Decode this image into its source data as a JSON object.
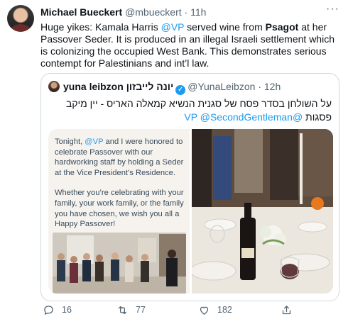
{
  "tweet": {
    "author_name": "Michael Bueckert",
    "author_handle": "@mbueckert",
    "separator": "·",
    "time": "11h",
    "more_label": "···",
    "text_1": "Huge yikes: Kamala Harris ",
    "mention_vp": "@VP",
    "text_2": " served wine from ",
    "bold_word": "Psagot",
    "text_3": " at her Passover Seder. It is produced in an illegal Israeli settlement which is colonizing the occupied West Bank. This demonstrates serious contempt for Palestinians and int’l law."
  },
  "quote": {
    "author_name": "yuna leibzon יונה לייבזון",
    "verified_glyph": "✓",
    "author_handle": "@YunaLeibzon",
    "separator": "·",
    "time": "12h",
    "text_line_1": "על השולחן בסדר פסח של סגנית הנשיא קמאלה האריס - יין מיקב",
    "text_line_2a": "פסגות ",
    "mention_vp": "@VP",
    "text_line_2b": " ",
    "mention_sg": "@SecondGentleman",
    "card": {
      "para1_a": "Tonight, ",
      "para1_mention": "@VP",
      "para1_b": " and I were honored to celebrate Passover with our hardworking staff by holding a Seder at the Vice President’s Residence.",
      "para2": "Whether you’re celebrating with your family, your work family, or the family you have chosen, we wish you all a Happy Passover!"
    }
  },
  "actions": {
    "reply_count": "16",
    "retweet_count": "77",
    "like_count": "182",
    "icons": [
      "reply-icon",
      "retweet-icon",
      "like-icon",
      "share-icon"
    ]
  },
  "colors": {
    "link": "#1d9bf0",
    "secondary_text": "#536471",
    "border": "#cfd9de"
  }
}
